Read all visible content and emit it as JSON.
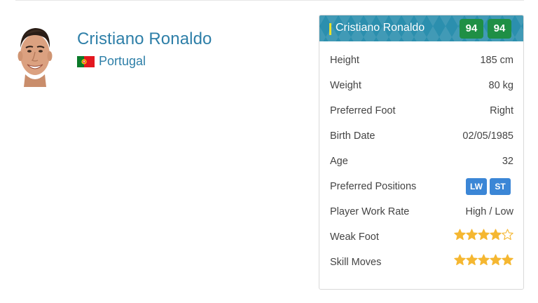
{
  "player": {
    "name": "Cristiano Ronaldo",
    "nation": "Portugal"
  },
  "card": {
    "header_name": "Cristiano Ronaldo",
    "ratings": [
      "94",
      "94"
    ],
    "rows": [
      {
        "label": "Height",
        "value": "185 cm"
      },
      {
        "label": "Weight",
        "value": "80 kg"
      },
      {
        "label": "Preferred Foot",
        "value": "Right"
      },
      {
        "label": "Birth Date",
        "value": "02/05/1985"
      },
      {
        "label": "Age",
        "value": "32"
      },
      {
        "label": "Preferred Positions",
        "positions": [
          "LW",
          "ST"
        ]
      },
      {
        "label": "Player Work Rate",
        "value": "High / Low"
      },
      {
        "label": "Weak Foot",
        "stars": 4,
        "stars_max": 5
      },
      {
        "label": "Skill Moves",
        "stars": 5,
        "stars_max": 5
      }
    ]
  },
  "colors": {
    "name_blue": "#2e7fa8",
    "header_teal": "#2b8fae",
    "rating_green": "#1f8f45",
    "position_blue": "#3b86d6",
    "star_gold": "#f5b731"
  },
  "icons": {
    "avatar": "player-photo",
    "flag": "portugal-flag-icon",
    "star": "star-icon"
  }
}
